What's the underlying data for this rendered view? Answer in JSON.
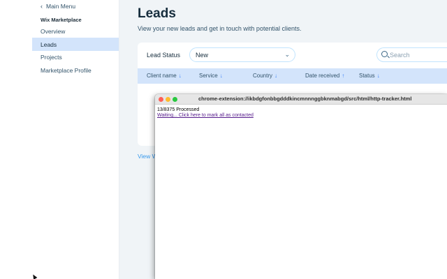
{
  "sidebar": {
    "back_label": "Main Menu",
    "section_title": "Wix Marketplace",
    "items": [
      {
        "label": "Overview"
      },
      {
        "label": "Leads"
      },
      {
        "label": "Projects"
      },
      {
        "label": "Marketplace Profile"
      }
    ]
  },
  "main": {
    "title": "Leads",
    "subtitle": "View your new leads and get in touch with potential clients.",
    "filter": {
      "label": "Lead Status",
      "value": "New"
    },
    "search": {
      "placeholder": "Search"
    },
    "table": {
      "columns": [
        {
          "label": "Client name",
          "sort": "↓"
        },
        {
          "label": "Service",
          "sort": "↓"
        },
        {
          "label": "Country",
          "sort": "↓"
        },
        {
          "label": "Date received",
          "sort": "↑"
        },
        {
          "label": "Status",
          "sort": "↓"
        }
      ]
    },
    "view_link": "View W"
  },
  "popup": {
    "title": "chrome-extension://ikbdgfonbbgdddkincmnnnggbknmabgd/src/html/http-tracker.html",
    "processed_text": "13/8375 Processed",
    "link_text": "Waiting... Click here to mark all as contacted"
  },
  "colors": {
    "accent": "#3899ec",
    "active_bg": "#d3e4fb",
    "page_bg": "#f0f4f7"
  }
}
